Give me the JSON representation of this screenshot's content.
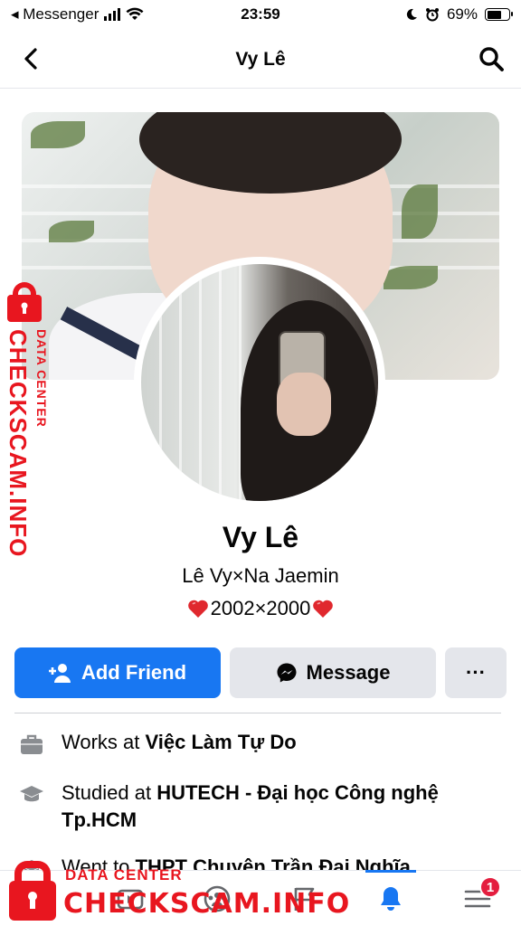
{
  "status_bar": {
    "carrier": "◂ Messenger",
    "time": "23:59",
    "battery": "69%",
    "battery_level": 0.69
  },
  "header": {
    "title": "Vy Lê",
    "back_icon": "chevron-left-icon",
    "search_icon": "search-icon"
  },
  "profile": {
    "name": "Vy Lê",
    "alternate_name": "Lê Vy×Na Jaemin",
    "bio": "2002×2000"
  },
  "actions": {
    "add_friend": "Add Friend",
    "message": "Message",
    "more": "···"
  },
  "intro": [
    {
      "prefix": "Works at ",
      "value": "Việc Làm Tự Do",
      "icon": "briefcase-icon"
    },
    {
      "prefix": "Studied at ",
      "value": "HUTECH - Đại học Công nghệ Tp.HCM",
      "icon": "graduation-cap-icon"
    },
    {
      "prefix": "Went to ",
      "value": "THPT Chuyên Trần Đại Nghĩa",
      "icon": "graduation-cap-icon"
    }
  ],
  "tabbar": {
    "menu_badge": "1"
  },
  "watermark": {
    "line1": "DATA CENTER",
    "line2": "CHECKSCAM.INFO"
  },
  "colors": {
    "primary": "#1877f2",
    "button_gray": "#e4e6eb",
    "badge_red": "#e41e3f",
    "watermark_red": "#e8161f",
    "heart_red": "#e0282e"
  }
}
